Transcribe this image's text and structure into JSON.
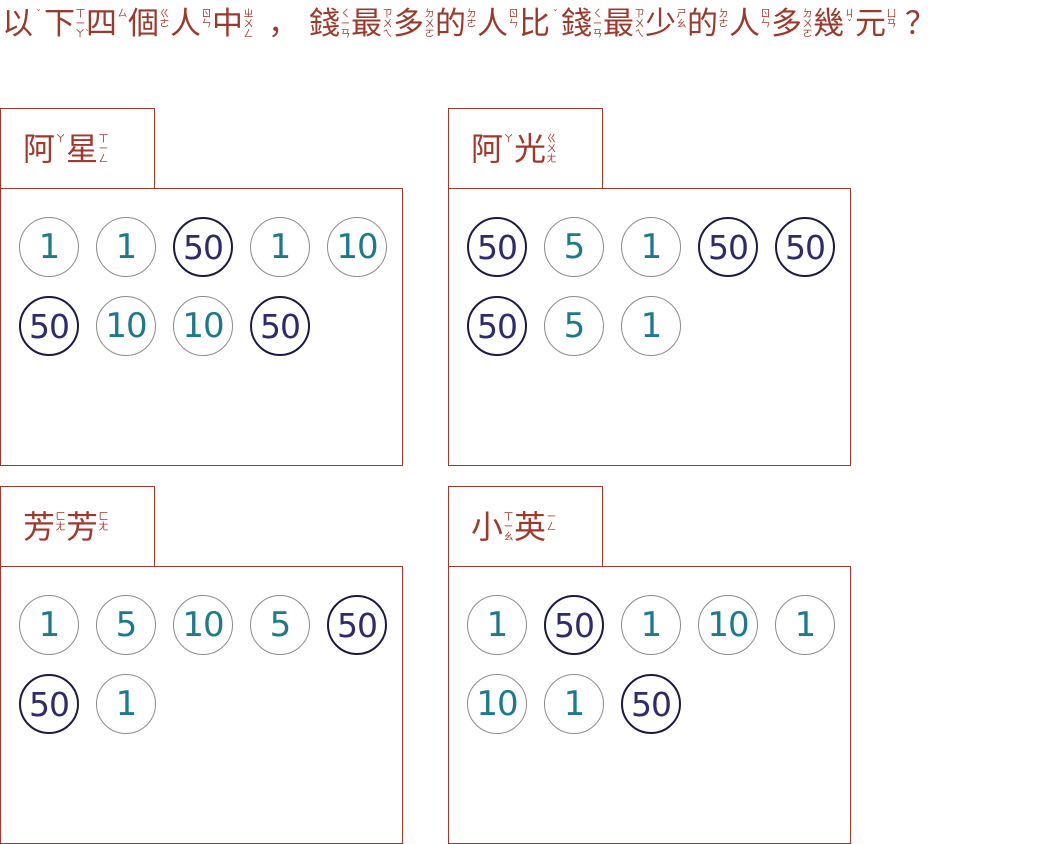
{
  "question": {
    "segments": [
      {
        "c": "以",
        "bp": [
          "ˇ"
        ]
      },
      {
        "c": "下",
        "bp": [
          "ㄒ",
          "ㄧ",
          "ㄚˋ"
        ]
      },
      {
        "c": "四",
        "bp": [
          "ㄙ"
        ]
      },
      {
        "c": "個",
        "bp": [
          "ㄍ",
          "ㄜ"
        ]
      },
      {
        "c": "人",
        "bp": [
          "ㄖ",
          "ㄣ"
        ]
      },
      {
        "c": "中",
        "bp": [
          "ㄓ",
          "ㄨ",
          "ㄥ"
        ]
      },
      {
        "c": "，",
        "punct": true
      },
      {
        "c": "錢",
        "bp": [
          "ㄑ",
          "ㄧ",
          "ㄢ"
        ]
      },
      {
        "c": "最",
        "bp": [
          "ㄗ",
          "ㄨ",
          "ㄟ"
        ]
      },
      {
        "c": "多",
        "bp": [
          "ㄉ",
          "ㄨ",
          "ㄛ"
        ]
      },
      {
        "c": "的",
        "bp": [
          "ㄉ",
          "ㄜ"
        ]
      },
      {
        "c": "人",
        "bp": [
          "ㄖ",
          "ㄣ"
        ]
      },
      {
        "c": "比",
        "bp": [
          "ˇ"
        ]
      },
      {
        "c": "錢",
        "bp": [
          "ㄑ",
          "ㄧ",
          "ㄢ"
        ]
      },
      {
        "c": "最",
        "bp": [
          "ㄗ",
          "ㄨ",
          "ㄟ"
        ]
      },
      {
        "c": "少",
        "bp": [
          "ㄕ",
          "ㄠ"
        ]
      },
      {
        "c": "的",
        "bp": [
          "ㄉ",
          "ㄜ"
        ]
      },
      {
        "c": "人",
        "bp": [
          "ㄖ",
          "ㄣ"
        ]
      },
      {
        "c": "多",
        "bp": [
          "ㄉ",
          "ㄨ",
          "ㄛ"
        ]
      },
      {
        "c": "幾",
        "bp": [
          "ㄐ",
          "ˇ"
        ]
      },
      {
        "c": "元",
        "bp": [
          "ㄩ",
          "ㄢ"
        ]
      },
      {
        "c": "？",
        "qmark": true
      }
    ]
  },
  "people": [
    {
      "name": [
        {
          "c": "阿",
          "bp": [
            "ㄚ"
          ]
        },
        {
          "c": "星",
          "bp": [
            "ㄒ",
            "ㄧ",
            "ㄥ"
          ]
        }
      ],
      "coins": [
        "1",
        "1",
        "50",
        "1",
        "10",
        "50",
        "10",
        "10",
        "50"
      ]
    },
    {
      "name": [
        {
          "c": "阿",
          "bp": [
            "ㄚ"
          ]
        },
        {
          "c": "光",
          "bp": [
            "ㄍ",
            "ㄨ",
            "ㄤ"
          ]
        }
      ],
      "coins": [
        "50",
        "5",
        "1",
        "50",
        "50",
        "50",
        "5",
        "1"
      ]
    },
    {
      "name": [
        {
          "c": "芳",
          "bp": [
            "ㄈ",
            "ㄤ"
          ]
        },
        {
          "c": "芳",
          "bp": [
            "ㄈ",
            "ㄤ"
          ]
        }
      ],
      "coins": [
        "1",
        "5",
        "10",
        "5",
        "50",
        "50",
        "1"
      ]
    },
    {
      "name": [
        {
          "c": "小",
          "bp": [
            "ㄒ",
            "ㄧ",
            "ㄠ"
          ]
        },
        {
          "c": "英",
          "bp": [
            "ㄧ",
            "ㄥ"
          ]
        }
      ],
      "coins": [
        "1",
        "50",
        "1",
        "10",
        "1",
        "10",
        "1",
        "50"
      ]
    }
  ],
  "colors": {
    "accent": "#a0382b",
    "coin_small_text": "#1c7a8a",
    "coin_big_text": "#2e2a6e",
    "coin_big_border": "#1c1a40",
    "coin_small_border": "#8c8c8c"
  }
}
